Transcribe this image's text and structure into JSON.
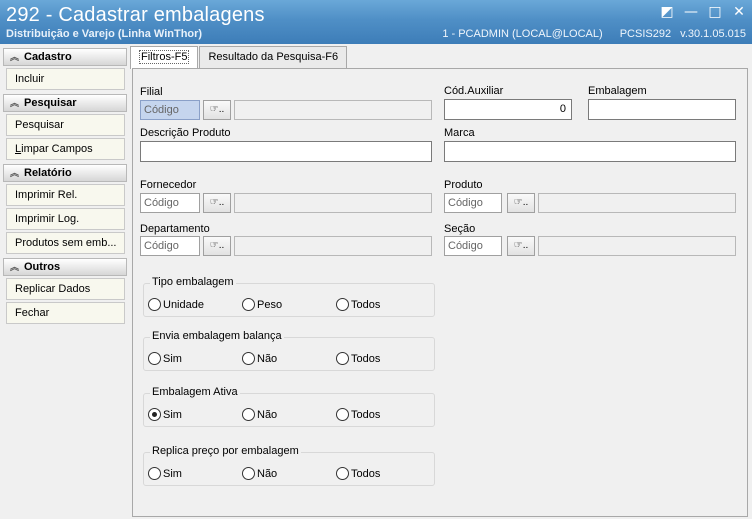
{
  "window": {
    "title": "292 - Cadastrar embalagens",
    "subtitle": "Distribuição e Varejo (Linha WinThor)",
    "session": "1 - PCADMIN (LOCAL@LOCAL)",
    "routine": "PCSIS292",
    "version": "v.30.1.05.015",
    "controls": {
      "restore": "◩",
      "minimize": "—",
      "maximize": "□",
      "close": "✕"
    }
  },
  "sidebar": {
    "groups": [
      {
        "title": "Cadastro",
        "items": [
          "Incluir"
        ]
      },
      {
        "title": "Pesquisar",
        "items": [
          "Pesquisar",
          "Limpar Campos"
        ]
      },
      {
        "title": "Relatório",
        "items": [
          "Imprimir Rel.",
          "Imprimir Log.",
          "Produtos sem emb..."
        ]
      },
      {
        "title": "Outros",
        "items": [
          "Replicar Dados",
          "Fechar"
        ]
      }
    ]
  },
  "tabs": [
    "Filtros-F5",
    "Resultado da Pesquisa-F6"
  ],
  "filters": {
    "filial": {
      "label": "Filial",
      "placeholder": "Código"
    },
    "cod_auxiliar": {
      "label": "Cód.Auxiliar",
      "value": "0"
    },
    "embalagem": {
      "label": "Embalagem",
      "value": ""
    },
    "descricao": {
      "label": "Descrição Produto",
      "value": ""
    },
    "marca": {
      "label": "Marca",
      "value": ""
    },
    "fornecedor": {
      "label": "Fornecedor",
      "placeholder": "Código"
    },
    "produto": {
      "label": "Produto",
      "placeholder": "Código"
    },
    "departamento": {
      "label": "Departamento",
      "placeholder": "Código"
    },
    "secao": {
      "label": "Seção",
      "placeholder": "Código"
    },
    "lookup_icon": "☞.."
  },
  "radio_groups": [
    {
      "title": "Tipo embalagem",
      "options": [
        "Unidade",
        "Peso",
        "Todos"
      ],
      "selected": -1
    },
    {
      "title": "Envia embalagem balança",
      "options": [
        "Sim",
        "Não",
        "Todos"
      ],
      "selected": -1
    },
    {
      "title": "Embalagem Ativa",
      "options": [
        "Sim",
        "Não",
        "Todos"
      ],
      "selected": 0
    },
    {
      "title": "Replica preço por embalagem",
      "options": [
        "Sim",
        "Não",
        "Todos"
      ],
      "selected": -1
    }
  ]
}
